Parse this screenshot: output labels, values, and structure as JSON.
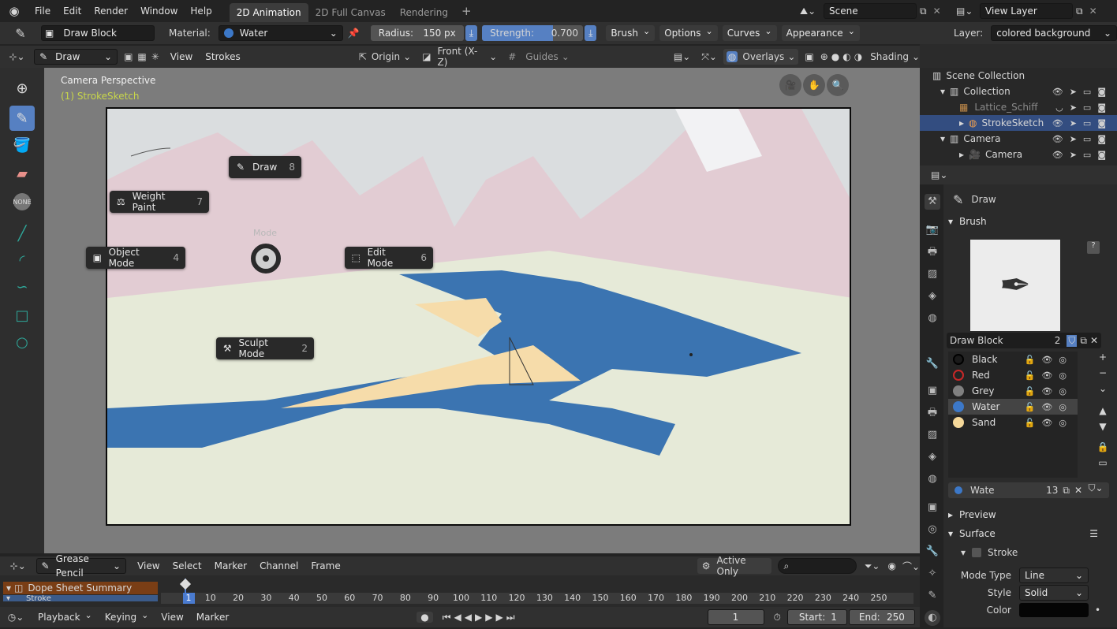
{
  "topbar": {
    "menus": [
      "File",
      "Edit",
      "Render",
      "Window",
      "Help"
    ],
    "tabs": [
      "2D Animation",
      "2D Full Canvas",
      "Rendering"
    ],
    "scene": "Scene",
    "view_layer": "View Layer"
  },
  "toolhdr": {
    "brush": "Draw Block",
    "material_label": "Material:",
    "material": "Water",
    "radius_label": "Radius:",
    "radius": "150 px",
    "strength_label": "Strength:",
    "strength": "0.700",
    "strength_fraction": 0.7,
    "menus": [
      "Brush",
      "Options",
      "Curves",
      "Appearance"
    ],
    "layer_label": "Layer:",
    "layer": "colored background"
  },
  "vphdr": {
    "mode": "Draw",
    "menus": [
      "View",
      "Strokes"
    ],
    "origin": "Origin",
    "view": "Front (X-Z)",
    "guides": "Guides",
    "overlays": "Overlays",
    "shading": "Shading"
  },
  "viewport": {
    "perspective": "Camera Perspective",
    "object": "(1) StrokeSketch",
    "pie_title": "Mode",
    "pie": [
      {
        "label": "Draw",
        "num": "8"
      },
      {
        "label": "Weight Paint",
        "num": "7"
      },
      {
        "label": "Object Mode",
        "num": "4"
      },
      {
        "label": "Edit Mode",
        "num": "6"
      },
      {
        "label": "Sculpt Mode",
        "num": "2"
      }
    ]
  },
  "outliner": {
    "items": [
      "Scene Collection",
      "Collection",
      "Lattice_Schiff",
      "StrokeSketch",
      "Camera",
      "Camera"
    ]
  },
  "properties": {
    "tool": "Draw",
    "brush_section": "Brush",
    "brush_name": "Draw Block",
    "brush_users": "2",
    "materials": [
      {
        "name": "Black",
        "color": "#1a1a1a"
      },
      {
        "name": "Red",
        "color": "#c82828"
      },
      {
        "name": "Grey",
        "color": "#808080"
      },
      {
        "name": "Water",
        "color": "#3c78c8"
      },
      {
        "name": "Sand",
        "color": "#f5d89a"
      }
    ],
    "slot_name": "Wate",
    "slot_users": "13",
    "preview": "Preview",
    "surface": "Surface",
    "stroke": "Stroke",
    "mode_type_label": "Mode Type",
    "mode_type": "Line",
    "style_label": "Style",
    "style": "Solid",
    "color_label": "Color"
  },
  "timeline": {
    "editor": "Grease Pencil",
    "menus": [
      "View",
      "Select",
      "Marker",
      "Channel",
      "Frame"
    ],
    "active_only": "Active Only",
    "summary": "Dope Sheet Summary",
    "stroke": "Stroke",
    "ticks": [
      "1",
      "10",
      "20",
      "30",
      "40",
      "50",
      "60",
      "70",
      "80",
      "90",
      "100",
      "110",
      "120",
      "130",
      "140",
      "150",
      "160",
      "170",
      "180",
      "190",
      "200",
      "210",
      "220",
      "230",
      "240",
      "250"
    ],
    "playback": "Playback",
    "keying": "Keying",
    "view": "View",
    "marker": "Marker",
    "frame": "1",
    "start_label": "Start:",
    "start": "1",
    "end_label": "End:",
    "end": "250"
  }
}
